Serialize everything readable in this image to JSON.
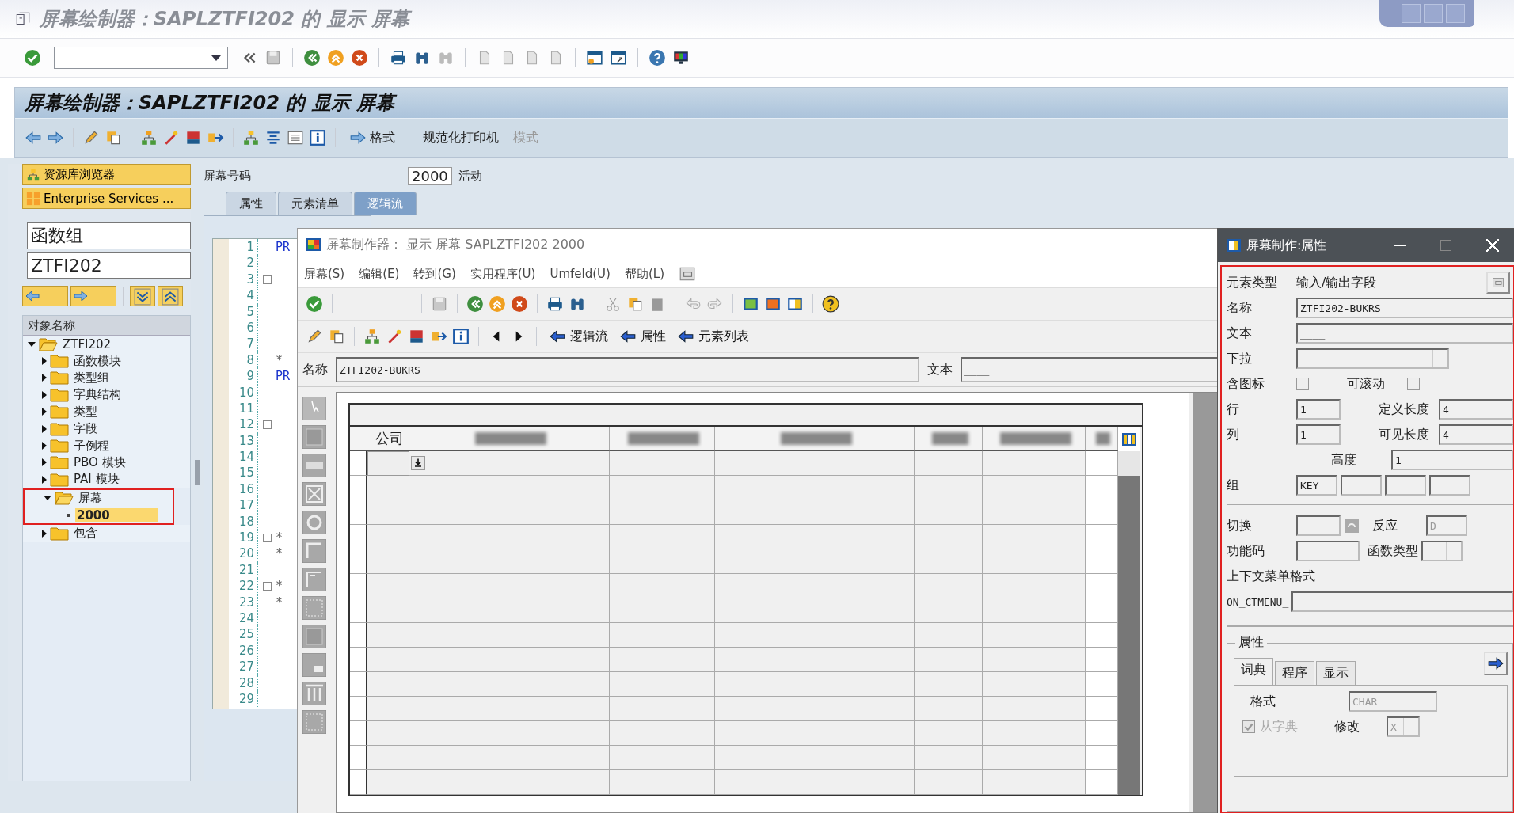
{
  "window": {
    "title": "屏幕绘制器：SAPLZTFI202 的 显示 屏幕"
  },
  "app_title": "屏幕绘制器：SAPLZTFI202 的 显示 屏幕",
  "app_toolbar": {
    "buttons": [
      {
        "label": "格式",
        "disabled": false
      },
      {
        "label": "规范化打印机",
        "disabled": false
      },
      {
        "label": "模式",
        "disabled": true
      }
    ]
  },
  "navigator": {
    "buttons": [
      "资源库浏览器",
      "Enterprise Services ..."
    ],
    "object_type": "函数组",
    "object_name": "ZTFI202",
    "tree_header": "对象名称",
    "tree": [
      {
        "label": "ZTFI202",
        "expanded": true,
        "selected": false,
        "children": [
          {
            "label": "函数模块",
            "expanded": false,
            "selected": false
          },
          {
            "label": "类型组",
            "expanded": false,
            "selected": false
          },
          {
            "label": "字典结构",
            "expanded": false,
            "selected": false
          },
          {
            "label": "类型",
            "expanded": false,
            "selected": false
          },
          {
            "label": "字段",
            "expanded": false,
            "selected": false
          },
          {
            "label": "子例程",
            "expanded": false,
            "selected": false
          },
          {
            "label": "PBO 模块",
            "expanded": false,
            "selected": false
          },
          {
            "label": "PAI 模块",
            "expanded": false,
            "selected": false
          },
          {
            "label": "屏幕",
            "expanded": true,
            "selected": false,
            "highlighted": true,
            "children": [
              {
                "label": "2000",
                "selected": true
              }
            ]
          },
          {
            "label": "包含",
            "expanded": false,
            "selected": false
          }
        ]
      }
    ]
  },
  "screen_number": {
    "label": "屏幕号码",
    "value": "2000",
    "status": "活动"
  },
  "tabs": [
    {
      "label": "属性",
      "selected": false
    },
    {
      "label": "元素清单",
      "selected": false
    },
    {
      "label": "逻辑流",
      "selected": true
    }
  ],
  "editor": {
    "lines": [
      {
        "no": "1",
        "code": "PR",
        "kind": "keyword",
        "fold": false
      },
      {
        "no": "2",
        "fold": false
      },
      {
        "no": "3",
        "fold": true
      },
      {
        "no": "4",
        "fold": false
      },
      {
        "no": "5",
        "fold": false
      },
      {
        "no": "6",
        "fold": false
      },
      {
        "no": "7",
        "fold": false
      },
      {
        "no": "8",
        "code": "*",
        "kind": "comment",
        "fold": false
      },
      {
        "no": "9",
        "code": "PR",
        "kind": "keyword",
        "fold": false
      },
      {
        "no": "10",
        "fold": false
      },
      {
        "no": "11",
        "fold": false
      },
      {
        "no": "12",
        "fold": true
      },
      {
        "no": "13",
        "fold": false
      },
      {
        "no": "14",
        "fold": false
      },
      {
        "no": "15",
        "fold": false
      },
      {
        "no": "16",
        "fold": false
      },
      {
        "no": "17",
        "fold": false
      },
      {
        "no": "18",
        "fold": false
      },
      {
        "no": "19",
        "code": "*",
        "kind": "comment",
        "fold": true
      },
      {
        "no": "20",
        "code": "*",
        "kind": "comment",
        "fold": false
      },
      {
        "no": "21",
        "fold": false
      },
      {
        "no": "22",
        "code": "*",
        "kind": "comment",
        "fold": true
      },
      {
        "no": "23",
        "code": "*",
        "kind": "comment",
        "fold": false
      },
      {
        "no": "24",
        "fold": false
      },
      {
        "no": "25",
        "fold": false
      },
      {
        "no": "26",
        "fold": false
      },
      {
        "no": "27",
        "fold": false
      },
      {
        "no": "28",
        "fold": false
      },
      {
        "no": "29",
        "fold": false
      }
    ]
  },
  "painter": {
    "title": "屏幕制作器：  显示 屏幕 SAPLZTFI202 2000",
    "menu": [
      "屏幕(S)",
      "编辑(E)",
      "转到(G)",
      "实用程序(U)",
      "Umfeld(U)",
      "帮助(L)"
    ],
    "nav_buttons": [
      "逻辑流",
      "属性",
      "元素列表"
    ],
    "name": {
      "label": "名称",
      "value": "ZTFI202-BUKRS"
    },
    "text": {
      "label": "文本",
      "value": "____"
    },
    "table": {
      "first_heading": "公司"
    }
  },
  "properties": {
    "title": "屏幕制作:属性",
    "element_type": {
      "label": "元素类型",
      "value": "输入/输出字段"
    },
    "name": {
      "label": "名称",
      "value": "ZTFI202-BUKRS"
    },
    "text": {
      "label": "文本",
      "value": "____"
    },
    "dropdown": {
      "label": "下拉"
    },
    "with_icon": {
      "label": "含图标",
      "checked": false
    },
    "scrollable": {
      "label": "可滚动",
      "checked": false
    },
    "line": {
      "label": "行",
      "value": "1"
    },
    "def_length": {
      "label": "定义长度",
      "value": "4"
    },
    "column": {
      "label": "列",
      "value": "1"
    },
    "vis_length": {
      "label": "可见长度",
      "value": "4"
    },
    "height": {
      "label": "高度",
      "value": "1"
    },
    "groups": {
      "label": "组",
      "values": [
        "KEY"
      ]
    },
    "toggle": {
      "label": "切换"
    },
    "response": {
      "label": "反应",
      "value": "D"
    },
    "fcode": {
      "label": "功能码"
    },
    "ftype": {
      "label": "函数类型"
    },
    "context_menu": {
      "label": "上下文菜单格式",
      "prefix": "ON_CTMENU_"
    },
    "attributes": {
      "label": "属性",
      "tabs": [
        {
          "label": "词典",
          "selected": true
        },
        {
          "label": "程序",
          "selected": false
        },
        {
          "label": "显示",
          "selected": false
        }
      ],
      "format": {
        "label": "格式",
        "value": "CHAR"
      },
      "from_dict": {
        "label": "从字典",
        "checked": true,
        "disabled": true
      },
      "modify": {
        "label": "修改",
        "value": "X"
      }
    }
  }
}
